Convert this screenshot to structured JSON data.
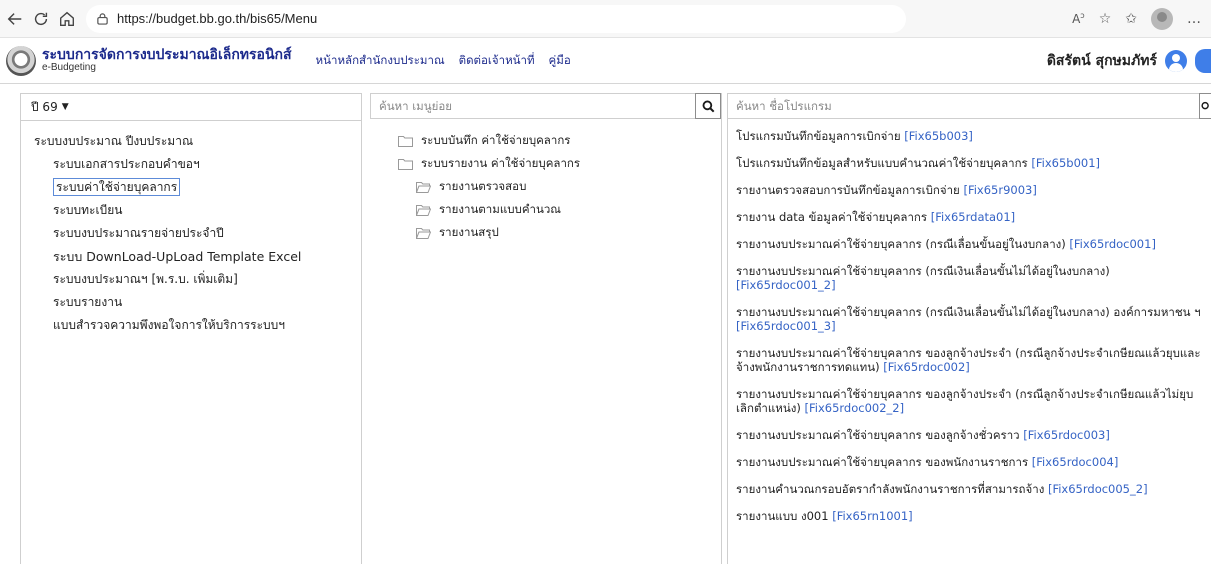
{
  "browser": {
    "url": "https://budget.bb.go.th/bis65/Menu",
    "right_label": "…"
  },
  "app": {
    "title": "ระบบการจัดการงบประมาณอิเล็กทรอนิกส์",
    "subtitle": "e-Budgeting",
    "nav": [
      "หน้าหลักสำนักงบประมาณ",
      "ติดต่อเจ้าหน้าที่",
      "คู่มือ"
    ],
    "user_name": "ดิสรัตน์ สุกษมภัทร์"
  },
  "year_selector": {
    "label": "ปี 69"
  },
  "left_menu": {
    "root": "ระบบงบประมาณ ปีงบประมาณ",
    "items": [
      "ระบบเอกสารประกอบคำขอฯ",
      "ระบบค่าใช้จ่ายบุคลากร",
      "ระบบทะเบียน",
      "ระบบงบประมาณรายจ่ายประจำปี",
      "ระบบ DownLoad-UpLoad Template Excel",
      "ระบบงบประมาณฯ [พ.ร.บ. เพิ่มเติม]",
      "ระบบรายงาน",
      "แบบสำรวจความพึงพอใจการให้บริการระบบฯ"
    ]
  },
  "menu_search": {
    "placeholder": "ค้นหา เมนูย่อย"
  },
  "program_search": {
    "placeholder": "ค้นหา ชื่อโปรแกรม"
  },
  "submenu_tree": [
    {
      "label": "ระบบบันทึก ค่าใช้จ่ายบุคลากร",
      "level": 1
    },
    {
      "label": "ระบบรายงาน ค่าใช้จ่ายบุคลากร",
      "level": 1
    },
    {
      "label": "รายงานตรวจสอบ",
      "level": 2
    },
    {
      "label": "รายงานตามแบบคำนวณ",
      "level": 2
    },
    {
      "label": "รายงานสรุป",
      "level": 2
    }
  ],
  "programs": [
    {
      "name": "โปรแกรมบันทึกข้อมูลการเบิกจ่าย",
      "code": "[Fix65b003]"
    },
    {
      "name": "โปรแกรมบันทึกข้อมูลสำหรับแบบคำนวณค่าใช้จ่ายบุคลากร",
      "code": "[Fix65b001]"
    },
    {
      "name": "รายงานตรวจสอบการบันทึกข้อมูลการเบิกจ่าย",
      "code": "[Fix65r9003]"
    },
    {
      "name": "รายงาน data ข้อมูลค่าใช้จ่ายบุคลากร",
      "code": "[Fix65rdata01]"
    },
    {
      "name": "รายงานงบประมาณค่าใช้จ่ายบุคลากร (กรณีเลื่อนขั้นอยู่ในงบกลาง)",
      "code": "[Fix65rdoc001]"
    },
    {
      "name": "รายงานงบประมาณค่าใช้จ่ายบุคลากร (กรณีเงินเลื่อนขั้นไม่ได้อยู่ในงบกลาง)",
      "code": "[Fix65rdoc001_2]"
    },
    {
      "name": "รายงานงบประมาณค่าใช้จ่ายบุคลากร (กรณีเงินเลื่อนขั้นไม่ได้อยู่ในงบกลาง) องค์การมหาชน ฯ",
      "code": "[Fix65rdoc001_3]"
    },
    {
      "name": "รายงานงบประมาณค่าใช้จ่ายบุคลากร ของลูกจ้างประจำ (กรณีลูกจ้างประจำเกษียณแล้วยุบและจ้างพนักงานราชการทดแทน)",
      "code": "[Fix65rdoc002]"
    },
    {
      "name": "รายงานงบประมาณค่าใช้จ่ายบุคลากร ของลูกจ้างประจำ (กรณีลูกจ้างประจำเกษียณแล้วไม่ยุบเลิกตำแหน่ง)",
      "code": "[Fix65rdoc002_2]"
    },
    {
      "name": "รายงานงบประมาณค่าใช้จ่ายบุคลากร ของลูกจ้างชั่วคราว",
      "code": "[Fix65rdoc003]"
    },
    {
      "name": "รายงานงบประมาณค่าใช้จ่ายบุคลากร ของพนักงานราชการ",
      "code": "[Fix65rdoc004]"
    },
    {
      "name": "รายงานคำนวณกรอบอัตรากำลังพนักงานราชการที่สามารถจ้าง",
      "code": "[Fix65rdoc005_2]"
    },
    {
      "name": "รายงานแบบ ง001",
      "code": "[Fix65rn1001]"
    }
  ],
  "colors": {
    "brand": "#1c2a8c",
    "link": "#3563c5",
    "accent": "#3f7ee8"
  }
}
